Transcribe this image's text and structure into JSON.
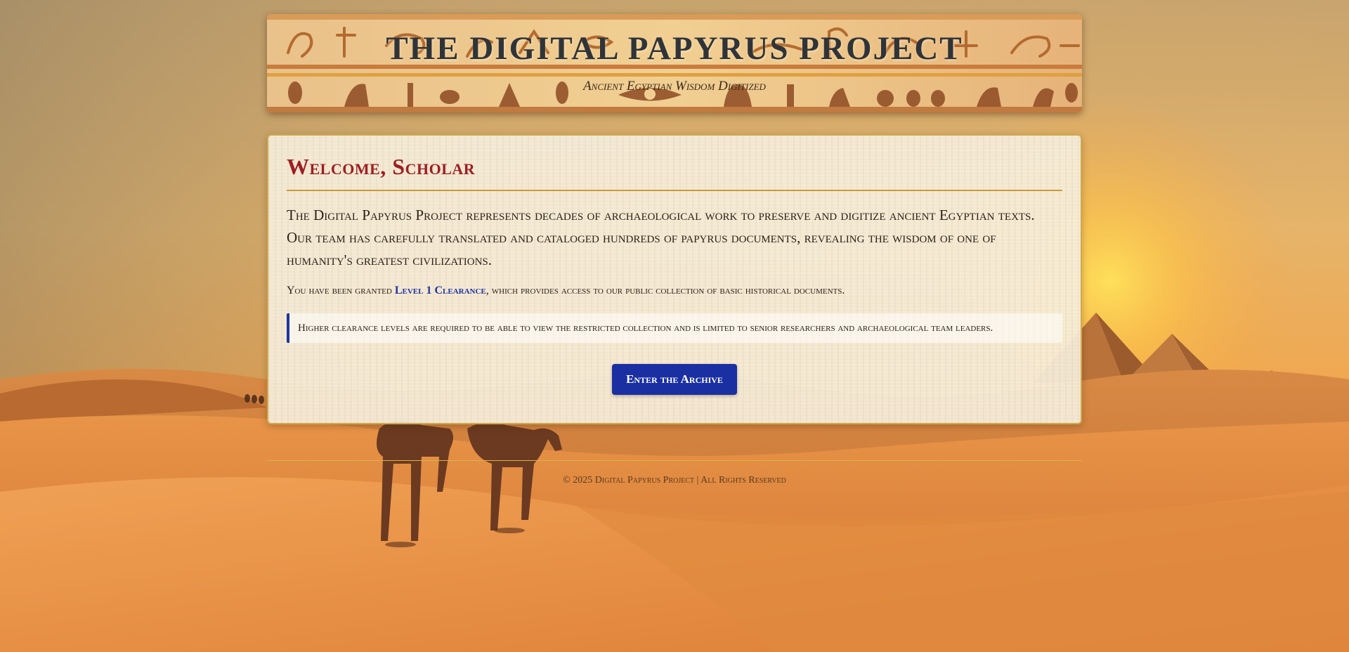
{
  "site": {
    "title": "THE DIGITAL PAPYRUS PROJECT",
    "subtitle": "Ancient Egyptian Wisdom Digitized"
  },
  "welcome": {
    "heading": "Welcome, Scholar",
    "intro": "The Digital Papyrus Project represents decades of archaeological work to preserve and digitize ancient Egyptian texts. Our team has carefully translated and cataloged hundreds of papyrus documents, revealing the wisdom of one of humanity's greatest civilizations.",
    "clearance_prefix": "You have been granted ",
    "clearance_level": "Level 1 Clearance",
    "clearance_suffix": ", which provides access to our public collection of basic historical documents.",
    "notice": "Higher clearance levels are required to be able to view the restricted collection and is limited to senior researchers and archaeological team leaders.",
    "button_label": "Enter the Archive"
  },
  "footer": {
    "text": "© 2025 Digital Papyrus Project | All Rights Reserved"
  },
  "colors": {
    "heading_red": "#9c1f23",
    "accent_blue": "#1a2fa2",
    "gold_border": "#cda94c",
    "sand": "#e9a659"
  },
  "icons": {
    "banner_art": "hieroglyph-relief",
    "background": "desert-dunes-pyramids-camels"
  }
}
